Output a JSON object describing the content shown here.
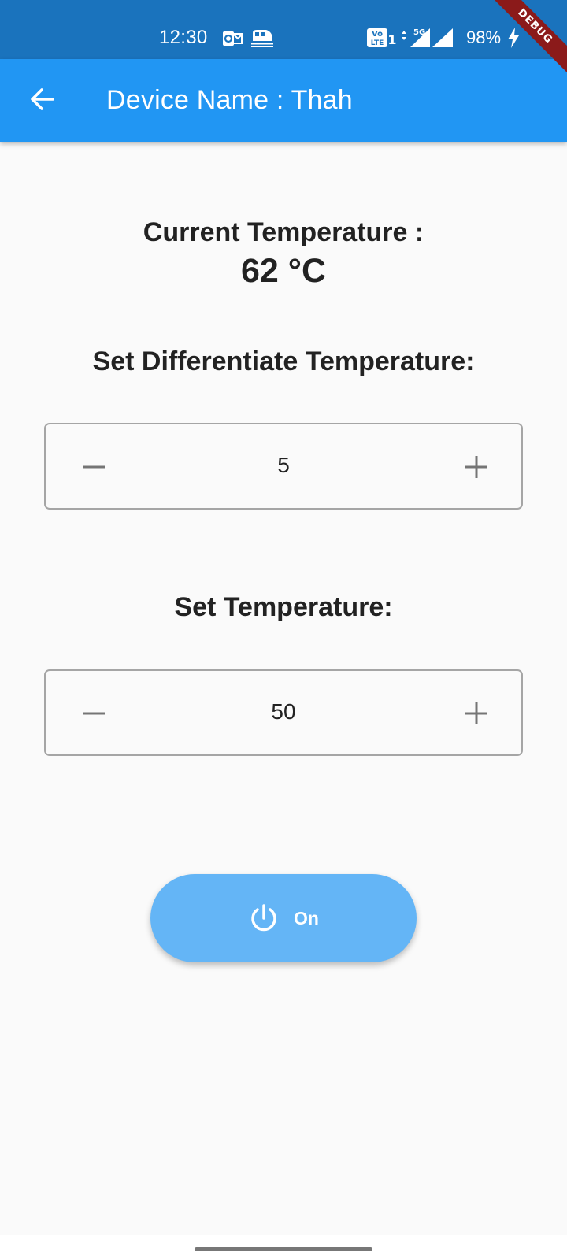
{
  "status_bar": {
    "time": "12:30",
    "battery_percent": "98%",
    "network_type": "5G",
    "volte_label": "Vo LTE",
    "sim_slot": "1",
    "icons": [
      "outlook-icon",
      "train-icon",
      "volte-icon",
      "signal-icon",
      "battery-charging-icon"
    ]
  },
  "debug_banner": "DEBUG",
  "app_bar": {
    "title": "Device Name : Thah",
    "back_icon": "arrow-back-icon"
  },
  "current_temperature": {
    "label": "Current Temperature :",
    "value": "62 °C"
  },
  "differential": {
    "label": "Set Differentiate Temperature:",
    "value": "5",
    "minus_icon": "minus-icon",
    "plus_icon": "plus-icon"
  },
  "set_temperature": {
    "label": "Set Temperature:",
    "value": "50",
    "minus_icon": "minus-icon",
    "plus_icon": "plus-icon"
  },
  "power": {
    "label": "On",
    "icon": "power-icon"
  },
  "colors": {
    "status_bar": "#1a73bd",
    "app_bar": "#2196f3",
    "power_button": "#64b5f6",
    "background": "#fafafa",
    "debug_ribbon": "#8b1a1a"
  }
}
